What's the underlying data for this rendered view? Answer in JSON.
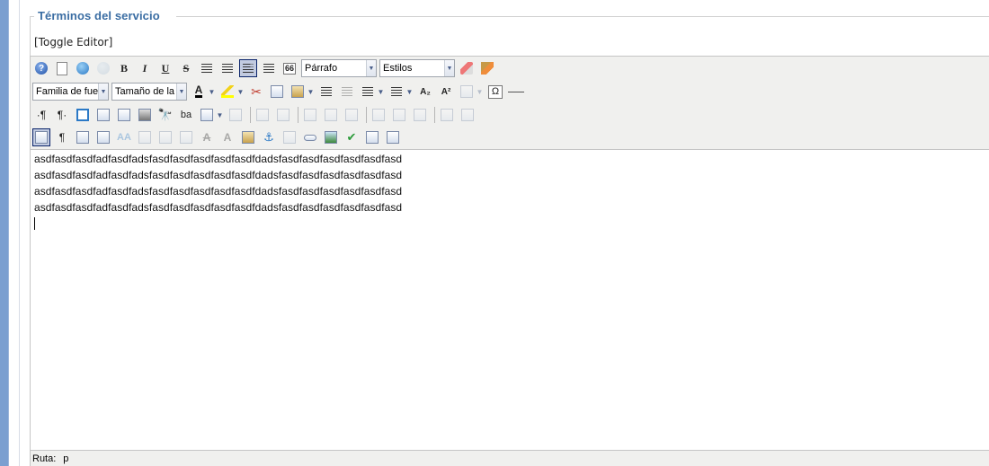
{
  "fieldset": {
    "legend": "Términos del servicio"
  },
  "toggle_editor": "[Toggle Editor]",
  "toolbar": {
    "format_select": "Párrafo",
    "styles_select": "Estilos",
    "font_family_select": "Familia de fuen",
    "font_size_select": "Tamaño de la f",
    "bold_label": "B",
    "italic_label": "I",
    "underline_label": "U",
    "strike_label": "S",
    "quote_label": "66",
    "omega_label": "Ω",
    "sub_label": "A₂",
    "sup_label": "A²",
    "para_label": "¶",
    "ltr_label": "·¶",
    "rtl_label": "¶·",
    "font_color_label": "A",
    "spell_label": "abc"
  },
  "content": {
    "lines": [
      "asdfasdfasdfadfasdfadsfasdfasdfasdfasdfasdfdadsfasdfasdfasdfasdfasdfasd",
      "asdfasdfasdfadfasdfadsfasdfasdfasdfasdfasdfdadsfasdfasdfasdfasdfasdfasd",
      "asdfasdfasdfadfasdfadsfasdfasdfasdfasdfasdfdadsfasdfasdfasdfasdfasdfasd",
      "asdfasdfasdfadfasdfadsfasdfasdfasdfasdfasdfdadsfasdfasdfasdfasdfasdfasd"
    ]
  },
  "status": {
    "label": "Ruta:",
    "path": "p"
  },
  "icons": [
    "help-icon",
    "new-document-icon",
    "undo-icon",
    "redo-icon",
    "align-justify-icon",
    "align-center-icon",
    "align-left-icon",
    "align-right-icon",
    "blockquote-icon",
    "eraser-icon",
    "cleanup-icon",
    "font-color-icon",
    "highlight-icon",
    "cut-icon",
    "copy-icon",
    "paste-icon",
    "indent-icon",
    "outdent-icon",
    "ordered-list-icon",
    "unordered-list-icon",
    "subscript-icon",
    "superscript-icon",
    "anchor-icon",
    "special-char-icon",
    "horizontal-rule-icon",
    "fullscreen-icon",
    "preview-icon",
    "print-icon",
    "search-icon",
    "replace-icon",
    "table-icon",
    "visual-aid-icon",
    "pagebreak-icon",
    "image-icon",
    "link-icon",
    "spellcheck-icon"
  ]
}
